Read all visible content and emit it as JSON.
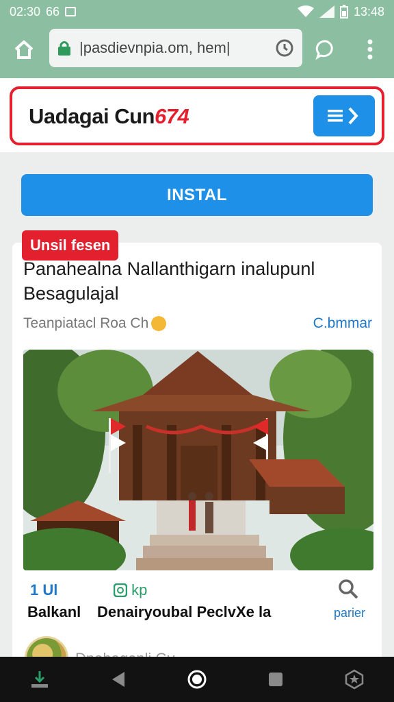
{
  "status_bar": {
    "time_left": "02:30 ",
    "label_left": "66",
    "time_right": "13:48"
  },
  "browser": {
    "url": "|pasdievnpia.om, hem|"
  },
  "header": {
    "title_main": "Uadagai Cun",
    "title_accent": "674"
  },
  "install_button": {
    "label": "INSTAL"
  },
  "card": {
    "badge": "Unsil fesen",
    "title": "Panahealna Nallanthigarn inalupunl Besagulajal",
    "meta": "Teanpiatacl Roa Ch",
    "link": "C.bmmar",
    "stats": {
      "stat_1": "1 Ul",
      "stat_2": "kp"
    },
    "labels": {
      "label_1": "Balkanl",
      "label_2": "Denairyoubal PeclvXe la",
      "label_3": "parier"
    },
    "author": "Dnahagenli Gy"
  },
  "colors": {
    "status_bg": "#8cbfa1",
    "accent_blue": "#1e90e8",
    "accent_red": "#e3202e"
  }
}
